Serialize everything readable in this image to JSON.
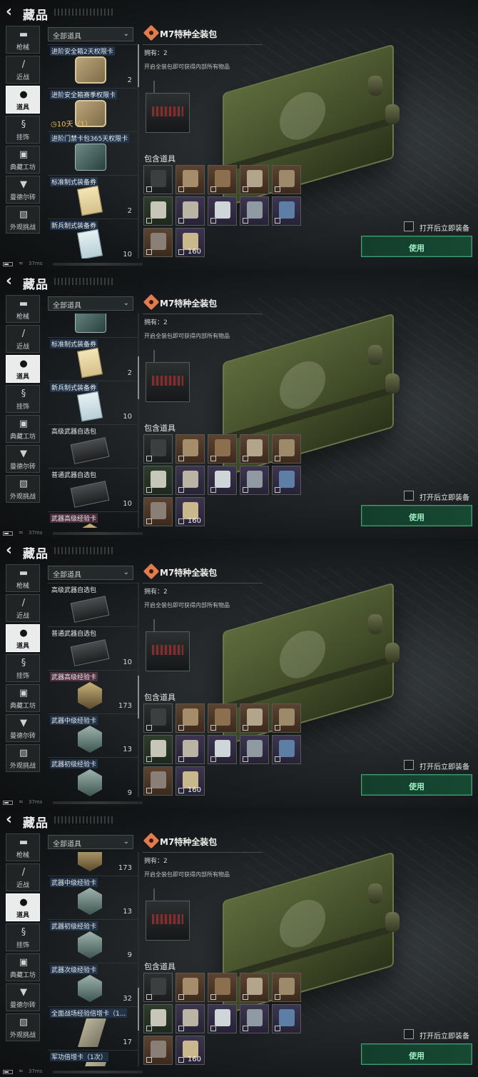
{
  "app": {
    "title": "藏品"
  },
  "categories": [
    {
      "label": "枪械",
      "icon": "pistol-icon",
      "glyph": "▬"
    },
    {
      "label": "近战",
      "icon": "knife-icon",
      "glyph": "/"
    },
    {
      "label": "道具",
      "icon": "items-cluster-icon",
      "glyph": "●"
    },
    {
      "label": "挂饰",
      "icon": "charm-icon",
      "glyph": "§"
    },
    {
      "label": "典藏工坊",
      "icon": "workshop-icon",
      "glyph": "▣"
    },
    {
      "label": "曼德尔砖",
      "icon": "mandel-brick-icon",
      "glyph": "▼"
    },
    {
      "label": "外观挑战",
      "icon": "appearance-challenge-icon",
      "glyph": "▧"
    }
  ],
  "active_category": "道具",
  "filter": {
    "label": "全部道具"
  },
  "detail": {
    "name": "M7特种全装包",
    "owned": "拥有：2",
    "description": "开启全装包即可获得内部所有物品",
    "contains_title": "包含道具",
    "contents": [
      {
        "icon": "rifle-icon",
        "rarity": "dark",
        "qty": ""
      },
      {
        "icon": "body-armor-tan-icon",
        "rarity": "tan",
        "qty": ""
      },
      {
        "icon": "chest-rig-icon",
        "rarity": "tan",
        "qty": ""
      },
      {
        "icon": "helmet-icon",
        "rarity": "tan",
        "qty": ""
      },
      {
        "icon": "vest-icon",
        "rarity": "tan",
        "qty": ""
      },
      {
        "icon": "syringe-icon",
        "rarity": "green",
        "qty": ""
      },
      {
        "icon": "bandage-icon",
        "rarity": "purple",
        "qty": ""
      },
      {
        "icon": "injector-icon",
        "rarity": "purple",
        "qty": ""
      },
      {
        "icon": "card-icon",
        "rarity": "purple",
        "qty": ""
      },
      {
        "icon": "medkit-icon",
        "rarity": "purple",
        "qty": ""
      },
      {
        "icon": "backpack-icon",
        "rarity": "tan",
        "qty": ""
      },
      {
        "icon": "ammo-box-icon",
        "rarity": "purple",
        "qty": "160"
      }
    ],
    "open_equip_label": "打开后立即装备",
    "use_label": "使用"
  },
  "status": {
    "ping": "37ms"
  },
  "panels": [
    {
      "items": [
        {
          "name": "进阶安全箱2天权限卡",
          "qty": "2",
          "timer": "",
          "art": "safe",
          "tag": "hl"
        },
        {
          "name": "进阶安全箱赛季权限卡",
          "qty": "",
          "timer": "10天（1）",
          "art": "safe",
          "tag": "hl"
        },
        {
          "name": "进阶门禁卡包365天权限卡",
          "qty": "",
          "timer": "",
          "art": "card",
          "tag": "hl"
        },
        {
          "name": "标准制式装备券",
          "qty": "2",
          "timer": "",
          "art": "paper",
          "tag": "hl"
        },
        {
          "name": "新兵制式装备券",
          "qty": "10",
          "timer": "",
          "art": "paperb",
          "tag": "hl"
        }
      ]
    },
    {
      "items": [
        {
          "name": "",
          "qty": "",
          "timer": "",
          "art": "card",
          "tag": ""
        },
        {
          "name": "标准制式装备券",
          "qty": "2",
          "timer": "",
          "art": "paper",
          "tag": "hl"
        },
        {
          "name": "新兵制式装备券",
          "qty": "10",
          "timer": "",
          "art": "paperb",
          "tag": "hl"
        },
        {
          "name": "高级武器自选包",
          "qty": "",
          "timer": "",
          "art": "case",
          "tag": ""
        },
        {
          "name": "普通武器自选包",
          "qty": "10",
          "timer": "",
          "art": "case",
          "tag": ""
        },
        {
          "name": "武器高级经验卡",
          "qty": "",
          "timer": "",
          "art": "hex gold",
          "tag": "gold"
        }
      ]
    },
    {
      "items": [
        {
          "name": "高级武器自选包",
          "qty": "",
          "timer": "",
          "art": "case",
          "tag": ""
        },
        {
          "name": "普通武器自选包",
          "qty": "10",
          "timer": "",
          "art": "case",
          "tag": ""
        },
        {
          "name": "武器高级经验卡",
          "qty": "173",
          "timer": "",
          "art": "hex gold",
          "tag": "gold"
        },
        {
          "name": "武器中级经验卡",
          "qty": "13",
          "timer": "",
          "art": "hex",
          "tag": "hl"
        },
        {
          "name": "武器初级经验卡",
          "qty": "9",
          "timer": "",
          "art": "hex",
          "tag": "hl"
        }
      ]
    },
    {
      "items": [
        {
          "name": "",
          "qty": "173",
          "timer": "",
          "art": "hex gold",
          "tag": ""
        },
        {
          "name": "武器中级经验卡",
          "qty": "13",
          "timer": "",
          "art": "hex",
          "tag": "hl"
        },
        {
          "name": "武器初级经验卡",
          "qty": "9",
          "timer": "",
          "art": "hex",
          "tag": "hl"
        },
        {
          "name": "武器次级经验卡",
          "qty": "32",
          "timer": "",
          "art": "hex",
          "tag": "hl"
        },
        {
          "name": "全面战场经验倍增卡（1...",
          "qty": "17",
          "timer": "",
          "art": "bar",
          "tag": "hl"
        },
        {
          "name": "军功倍增卡（1次）",
          "qty": "",
          "timer": "",
          "art": "bar",
          "tag": "hl"
        }
      ]
    }
  ],
  "colors": {
    "accent_green": "#3ea077",
    "use_text": "#9ef0c6",
    "timer_gold": "#f1c05a",
    "rarity_tan": "#5b4330",
    "rarity_purple": "#3d3550",
    "rarity_green": "#2e3d2c",
    "icon_orange": "#e17c4e"
  }
}
